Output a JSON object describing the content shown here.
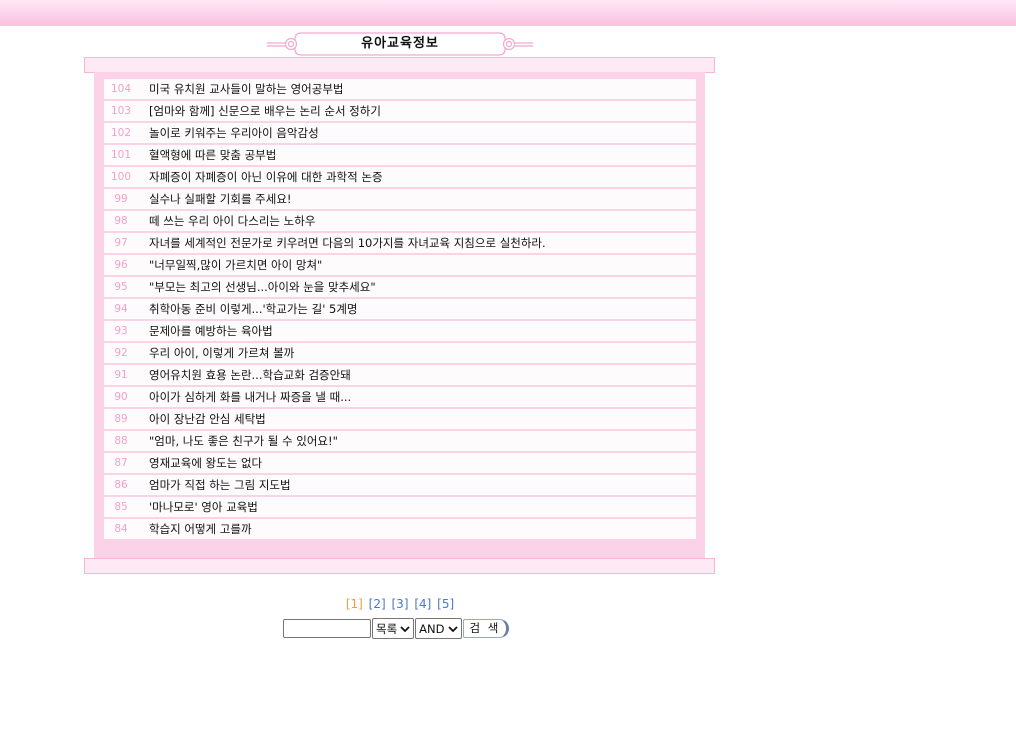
{
  "header": {
    "title": "유아교육정보"
  },
  "articles": [
    {
      "num": "104",
      "title": "미국 유치원 교사들이 말하는 영어공부법"
    },
    {
      "num": "103",
      "title": "[엄마와 함께] 신문으로 배우는 논리 순서 정하기"
    },
    {
      "num": "102",
      "title": "놀이로 키워주는 우리아이 음악감성"
    },
    {
      "num": "101",
      "title": "혈액형에 따른 맞춤 공부법"
    },
    {
      "num": "100",
      "title": "자폐증이 자폐증이 아닌 이유에 대한 과학적 논증"
    },
    {
      "num": "99",
      "title": "실수나 실패할 기회를 주세요!"
    },
    {
      "num": "98",
      "title": "떼 쓰는 우리 아이 다스리는 노하우"
    },
    {
      "num": "97",
      "title": "자녀를 세계적인 전문가로 키우려면 다음의 10가지를 자녀교육 지침으로 실천하라."
    },
    {
      "num": "96",
      "title": "\"너무일찍,많이 가르치면 아이 망쳐\""
    },
    {
      "num": "95",
      "title": "\"부모는 최고의 선생님...아이와 눈을 맞추세요\""
    },
    {
      "num": "94",
      "title": "취학아동 준비 이렇게...'학교가는 길' 5계명"
    },
    {
      "num": "93",
      "title": "문제아를 예방하는 육아법"
    },
    {
      "num": "92",
      "title": "우리 아이, 이렇게 가르쳐 볼까"
    },
    {
      "num": "91",
      "title": "영어유치원 효용 논란...학습교화 검증안돼"
    },
    {
      "num": "90",
      "title": "아이가 심하게 화를 내거나 짜증을 낼 때..."
    },
    {
      "num": "89",
      "title": "아이 장난감 안심 세탁법"
    },
    {
      "num": "88",
      "title": "\"엄마, 나도 좋은 친구가 될 수 있어요!\""
    },
    {
      "num": "87",
      "title": "영재교육에 왕도는 없다"
    },
    {
      "num": "86",
      "title": "엄마가 직접 하는 그림 지도법"
    },
    {
      "num": "85",
      "title": "'마나모로' 영아 교육법"
    },
    {
      "num": "84",
      "title": "학습지 어떻게 고를까"
    }
  ],
  "pagination": {
    "pages": [
      "[1]",
      "[2]",
      "[3]",
      "[4]",
      "[5]"
    ],
    "current": "[1]"
  },
  "search": {
    "input_value": "",
    "scope_selected": "목록",
    "operator_selected": "AND",
    "button_label": "검 색"
  },
  "colors": {
    "accent_pink": "#fbd2e7",
    "number_pink": "#f2a2c9",
    "link_blue": "#4a78c8",
    "current_page_orange": "#f59c40"
  }
}
